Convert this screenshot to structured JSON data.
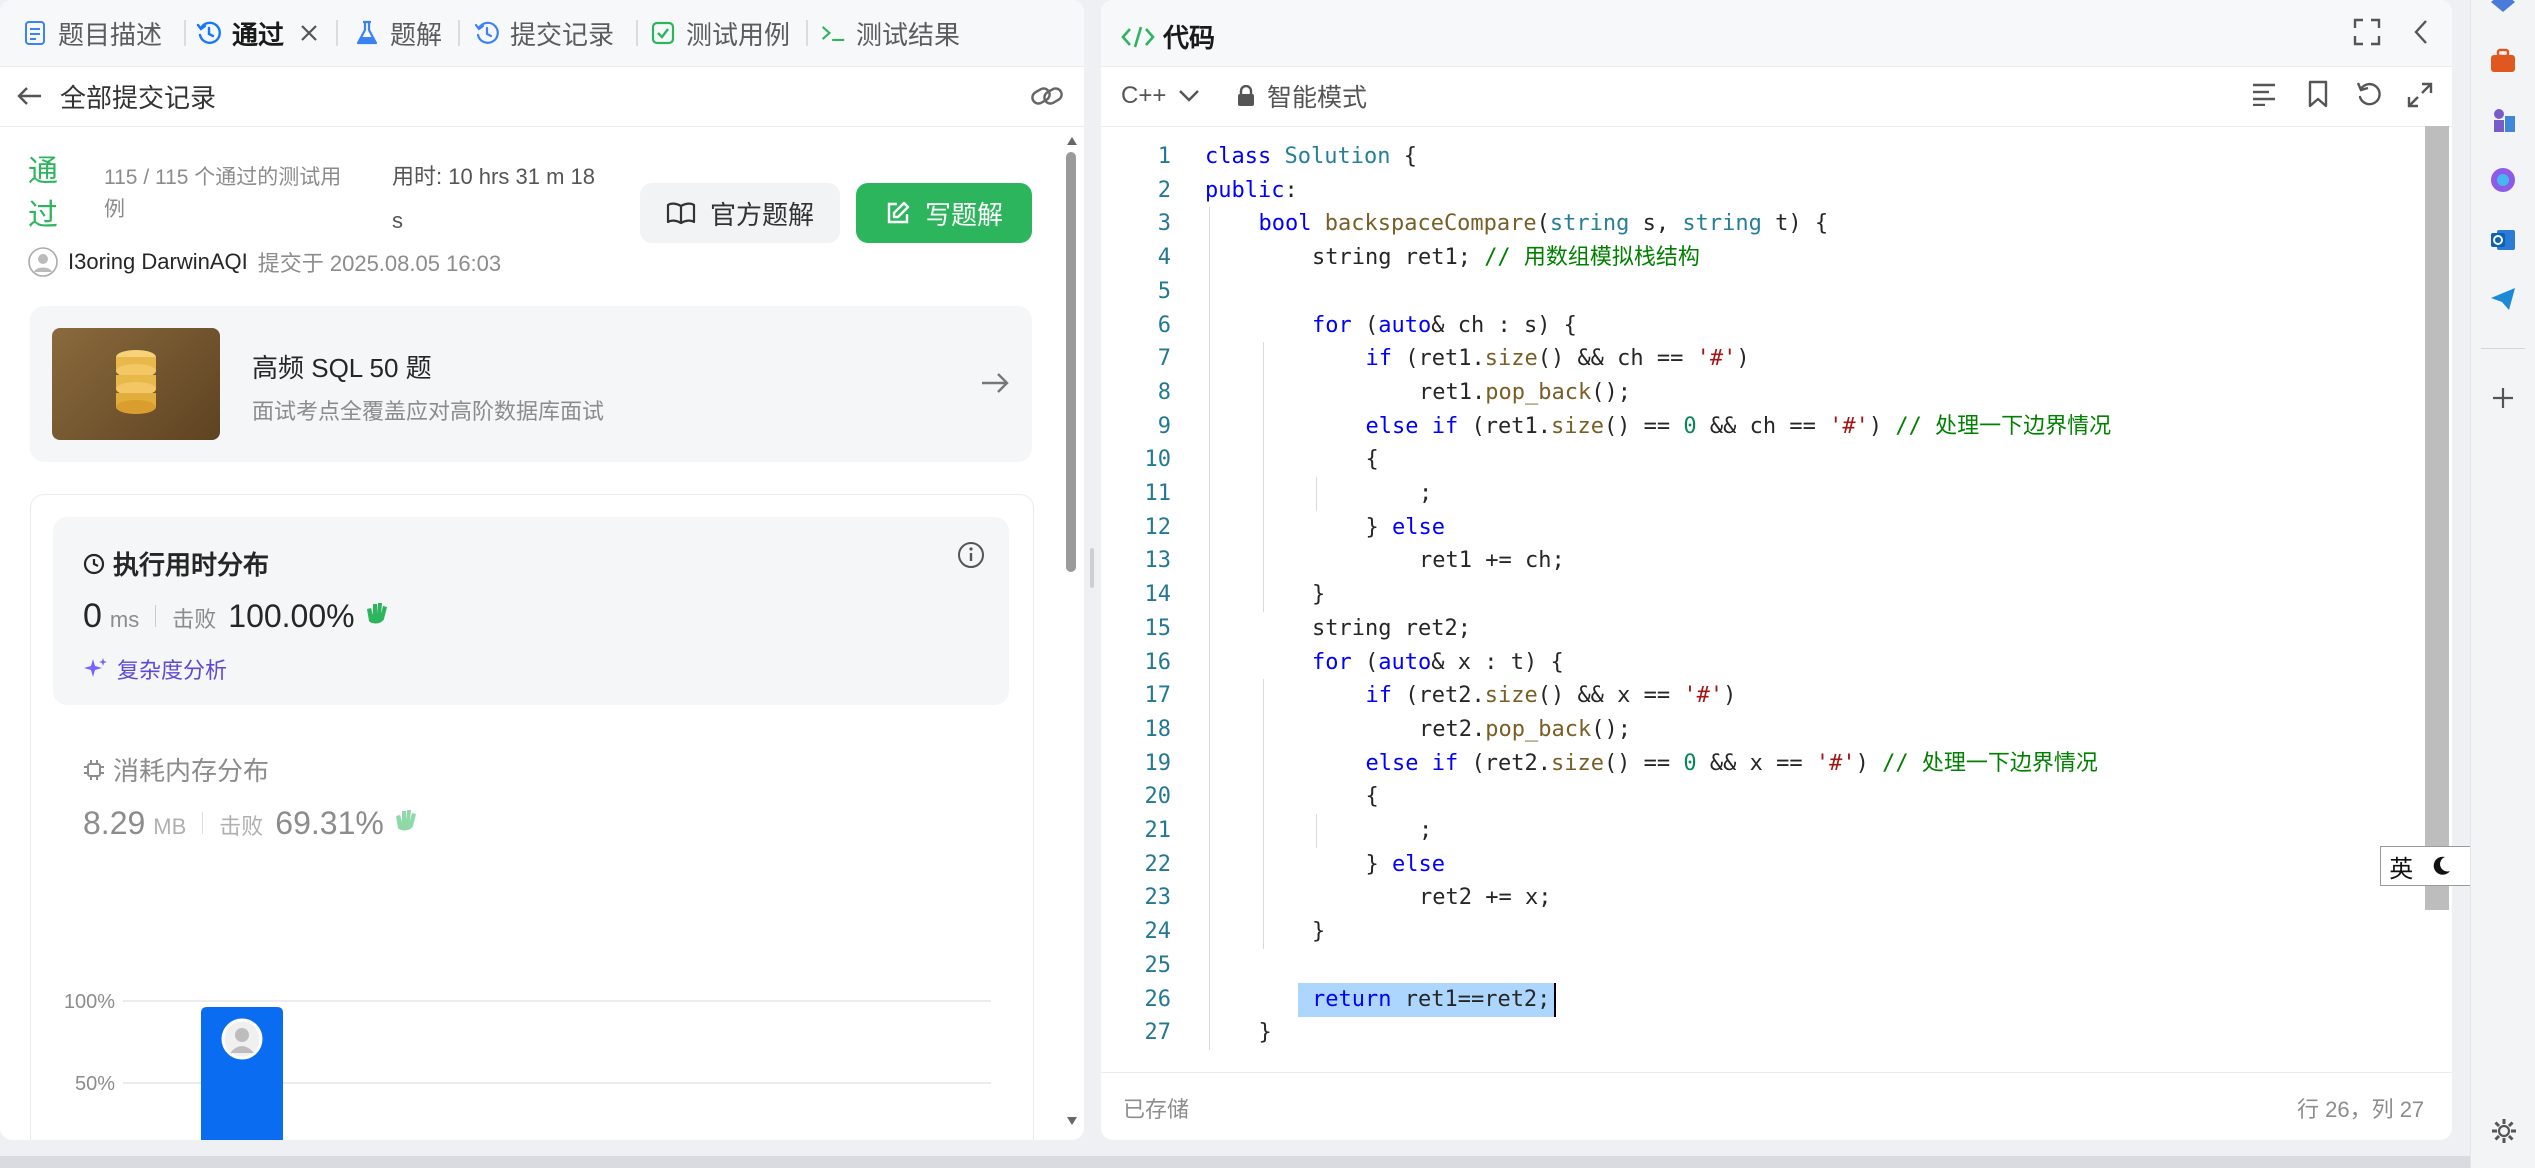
{
  "tabs": [
    {
      "label": "题目描述",
      "icon": "document-icon"
    },
    {
      "label": "通过",
      "icon": "history-icon",
      "active": true
    },
    {
      "label": "题解",
      "icon": "flask-icon"
    },
    {
      "label": "提交记录",
      "icon": "history-icon"
    },
    {
      "label": "测试用例",
      "icon": "checkbox-icon"
    },
    {
      "label": "测试结果",
      "icon": "terminal-icon"
    }
  ],
  "header": {
    "back_label": "全部提交记录"
  },
  "submission": {
    "status_line1": "通",
    "status_line2": "过",
    "testcases_line1": "115 / 115 个通过的测试用",
    "testcases_line2": "例",
    "runtime_line1": "用时: 10 hrs 31 m 18",
    "runtime_line2": "s",
    "user": "I3oring DarwinAQI",
    "submitted": "提交于 2025.08.05 16:03",
    "official_solution": "官方题解",
    "write_solution": "写题解"
  },
  "promo": {
    "title": "高频 SQL 50 题",
    "subtitle": "面试考点全覆盖应对高阶数据库面试"
  },
  "runtime_card": {
    "title": "执行用时分布",
    "value": "0",
    "unit": "ms",
    "beats_label": "击败",
    "beats": "100.00%",
    "analysis": "复杂度分析"
  },
  "memory_card": {
    "title": "消耗内存分布",
    "value": "8.29",
    "unit": "MB",
    "beats_label": "击败",
    "beats": "69.31%"
  },
  "chart_data": {
    "type": "bar",
    "yticks": [
      "100%",
      "50%"
    ],
    "ylim": [
      0,
      100
    ],
    "bars": [
      {
        "value": 100,
        "highlighted": true
      }
    ]
  },
  "editor": {
    "title": "代码",
    "language": "C++",
    "mode": "智能模式",
    "saved": "已存储",
    "cursor": "行 26，列 27",
    "colors": {
      "accent": "#2db55d",
      "keyword": "#0000ff",
      "type": "#267f99",
      "function": "#795e26",
      "string": "#a31515",
      "number": "#098658",
      "comment": "#008000"
    },
    "lines": [
      {
        "n": "1",
        "indent": 0,
        "tokens": [
          [
            "kw",
            "class"
          ],
          [
            "",
            " "
          ],
          [
            "ty",
            "Solution"
          ],
          [
            "",
            " {"
          ]
        ]
      },
      {
        "n": "2",
        "indent": 0,
        "tokens": [
          [
            "kw",
            "public"
          ],
          [
            "",
            ":"
          ]
        ]
      },
      {
        "n": "3",
        "indent": 1,
        "tokens": [
          [
            "kw",
            "bool"
          ],
          [
            "",
            " "
          ],
          [
            "fn",
            "backspaceCompare"
          ],
          [
            "",
            "("
          ],
          [
            "ty",
            "string"
          ],
          [
            "",
            " s, "
          ],
          [
            "ty",
            "string"
          ],
          [
            "",
            " t) {"
          ]
        ]
      },
      {
        "n": "4",
        "indent": 2,
        "tokens": [
          [
            "",
            "string ret1; "
          ],
          [
            "cm",
            "// 用数组模拟栈结构"
          ]
        ]
      },
      {
        "n": "5",
        "indent": 2,
        "tokens": []
      },
      {
        "n": "6",
        "indent": 2,
        "tokens": [
          [
            "kw",
            "for"
          ],
          [
            "",
            " ("
          ],
          [
            "kw",
            "auto"
          ],
          [
            "",
            "& ch : s) {"
          ]
        ]
      },
      {
        "n": "7",
        "indent": 3,
        "tokens": [
          [
            "kw",
            "if"
          ],
          [
            "",
            " (ret1."
          ],
          [
            "fn",
            "size"
          ],
          [
            "",
            "() && ch == "
          ],
          [
            "str",
            "'#'"
          ],
          [
            "",
            ")"
          ]
        ]
      },
      {
        "n": "8",
        "indent": 4,
        "tokens": [
          [
            "",
            "ret1."
          ],
          [
            "fn",
            "pop_back"
          ],
          [
            "",
            "();"
          ]
        ]
      },
      {
        "n": "9",
        "indent": 3,
        "tokens": [
          [
            "kw",
            "else"
          ],
          [
            "",
            " "
          ],
          [
            "kw",
            "if"
          ],
          [
            "",
            " (ret1."
          ],
          [
            "fn",
            "size"
          ],
          [
            "",
            "() == "
          ],
          [
            "num",
            "0"
          ],
          [
            "",
            " && ch == "
          ],
          [
            "str",
            "'#'"
          ],
          [
            "",
            ") "
          ],
          [
            "cm",
            "// 处理一下边界情况"
          ]
        ]
      },
      {
        "n": "10",
        "indent": 3,
        "tokens": [
          [
            "",
            "{"
          ]
        ]
      },
      {
        "n": "11",
        "indent": 4,
        "tokens": [
          [
            "",
            ";"
          ]
        ]
      },
      {
        "n": "12",
        "indent": 3,
        "tokens": [
          [
            "",
            "} "
          ],
          [
            "kw",
            "else"
          ]
        ]
      },
      {
        "n": "13",
        "indent": 4,
        "tokens": [
          [
            "",
            "ret1 += ch;"
          ]
        ]
      },
      {
        "n": "14",
        "indent": 2,
        "tokens": [
          [
            "",
            "}"
          ]
        ]
      },
      {
        "n": "15",
        "indent": 2,
        "tokens": [
          [
            "",
            "string ret2;"
          ]
        ]
      },
      {
        "n": "16",
        "indent": 2,
        "tokens": [
          [
            "kw",
            "for"
          ],
          [
            "",
            " ("
          ],
          [
            "kw",
            "auto"
          ],
          [
            "",
            "& x : t) {"
          ]
        ]
      },
      {
        "n": "17",
        "indent": 3,
        "tokens": [
          [
            "kw",
            "if"
          ],
          [
            "",
            " (ret2."
          ],
          [
            "fn",
            "size"
          ],
          [
            "",
            "() && x == "
          ],
          [
            "str",
            "'#'"
          ],
          [
            "",
            ")"
          ]
        ]
      },
      {
        "n": "18",
        "indent": 4,
        "tokens": [
          [
            "",
            "ret2."
          ],
          [
            "fn",
            "pop_back"
          ],
          [
            "",
            "();"
          ]
        ]
      },
      {
        "n": "19",
        "indent": 3,
        "tokens": [
          [
            "kw",
            "else"
          ],
          [
            "",
            " "
          ],
          [
            "kw",
            "if"
          ],
          [
            "",
            " (ret2."
          ],
          [
            "fn",
            "size"
          ],
          [
            "",
            "() == "
          ],
          [
            "num",
            "0"
          ],
          [
            "",
            " && x == "
          ],
          [
            "str",
            "'#'"
          ],
          [
            "",
            ") "
          ],
          [
            "cm",
            "// 处理一下边界情况"
          ]
        ]
      },
      {
        "n": "20",
        "indent": 3,
        "tokens": [
          [
            "",
            "{"
          ]
        ]
      },
      {
        "n": "21",
        "indent": 4,
        "tokens": [
          [
            "",
            ";"
          ]
        ]
      },
      {
        "n": "22",
        "indent": 3,
        "tokens": [
          [
            "",
            "} "
          ],
          [
            "kw",
            "else"
          ]
        ]
      },
      {
        "n": "23",
        "indent": 4,
        "tokens": [
          [
            "",
            "ret2 += x;"
          ]
        ]
      },
      {
        "n": "24",
        "indent": 2,
        "tokens": [
          [
            "",
            "}"
          ]
        ]
      },
      {
        "n": "25",
        "indent": 2,
        "tokens": []
      },
      {
        "n": "26",
        "indent": 2,
        "tokens": [
          [
            "kw",
            "return"
          ],
          [
            "",
            " ret1==ret2;"
          ]
        ],
        "selected": true
      },
      {
        "n": "27",
        "indent": 1,
        "tokens": [
          [
            "",
            "}"
          ]
        ]
      }
    ]
  },
  "ime": {
    "lang": "英"
  }
}
